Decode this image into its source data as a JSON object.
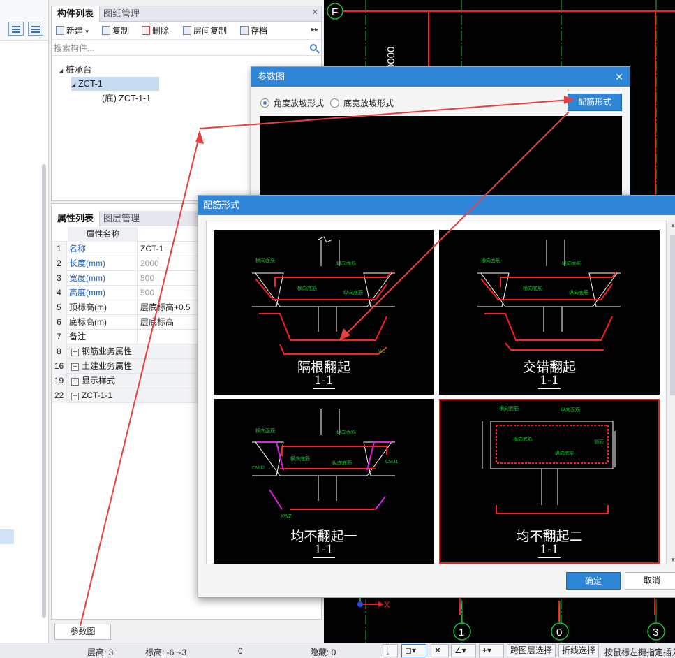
{
  "component_panel": {
    "tabs": [
      "构件列表",
      "图纸管理"
    ],
    "toolbar": {
      "new": "新建",
      "copy": "复制",
      "delete": "删除",
      "floor_copy": "层间复制",
      "archive": "存档"
    },
    "search_placeholder": "搜索构件...",
    "tree": {
      "root": "桩承台",
      "child": "ZCT-1",
      "grandchild": "(底) ZCT-1-1"
    }
  },
  "property_panel": {
    "tabs": [
      "属性列表",
      "图层管理"
    ],
    "header": "属性名称",
    "rows": [
      {
        "idx": "1",
        "name": "名称",
        "value": "ZCT-1"
      },
      {
        "idx": "2",
        "name": "长度(mm)",
        "value": "2000"
      },
      {
        "idx": "3",
        "name": "宽度(mm)",
        "value": "800"
      },
      {
        "idx": "4",
        "name": "高度(mm)",
        "value": "500"
      },
      {
        "idx": "5",
        "name": "顶标高(m)",
        "value": "层底标高+0.5"
      },
      {
        "idx": "6",
        "name": "底标高(m)",
        "value": "层底标高"
      },
      {
        "idx": "7",
        "name": "备注",
        "value": ""
      },
      {
        "idx": "8",
        "name": "钢筋业务属性",
        "value": ""
      },
      {
        "idx": "16",
        "name": "土建业务属性",
        "value": ""
      },
      {
        "idx": "19",
        "name": "显示样式",
        "value": ""
      },
      {
        "idx": "22",
        "name": "ZCT-1-1",
        "value": ""
      }
    ]
  },
  "param_button": "参数图",
  "param_dialog": {
    "title": "参数图",
    "radio_angle": "角度放坡形式",
    "radio_width": "底宽放坡形式",
    "rebar_button": "配筋形式"
  },
  "rebar_dialog": {
    "title": "配筋形式",
    "options": [
      {
        "name": "隔根翻起",
        "section": "1-1",
        "selected": false
      },
      {
        "name": "交错翻起",
        "section": "1-1",
        "selected": false
      },
      {
        "name": "均不翻起一",
        "section": "1-1",
        "selected": false
      },
      {
        "name": "均不翻起二",
        "section": "1-1",
        "selected": true
      }
    ],
    "drawing_labels": {
      "transverse_top": "横向面筋",
      "longitudinal_top": "纵向面筋",
      "transverse_bottom": "横向底筋",
      "longitudinal_bottom": "纵向底筋",
      "side": "侧面",
      "codes": [
        "XMJ",
        "YMJ",
        "XDJ",
        "YDJ",
        "CMJ",
        "CMJ1",
        "CMJ2",
        "XWZ",
        "YWZ",
        "WJ"
      ]
    },
    "ok": "确定",
    "cancel": "取消"
  },
  "cad": {
    "axis_top": "F",
    "dim_text": "0000",
    "axis_bottom": [
      "1",
      "0",
      "3"
    ],
    "ucs_x": "X"
  },
  "status_bar": {
    "floor_height": "层高:   3",
    "elevation": "标高:   -6~-3",
    "zero": "0",
    "hidden": "隐藏:  0",
    "cross_layer": "跨图层选择",
    "polyline": "折线选择",
    "hint": "按鼠标左键指定插入"
  },
  "colors": {
    "accent": "#2f86d8",
    "annotation_arrow": "#e84040",
    "selected_border": "#e32020",
    "cad_red": "#ff1e1e",
    "cad_green": "#1fbf3a"
  }
}
